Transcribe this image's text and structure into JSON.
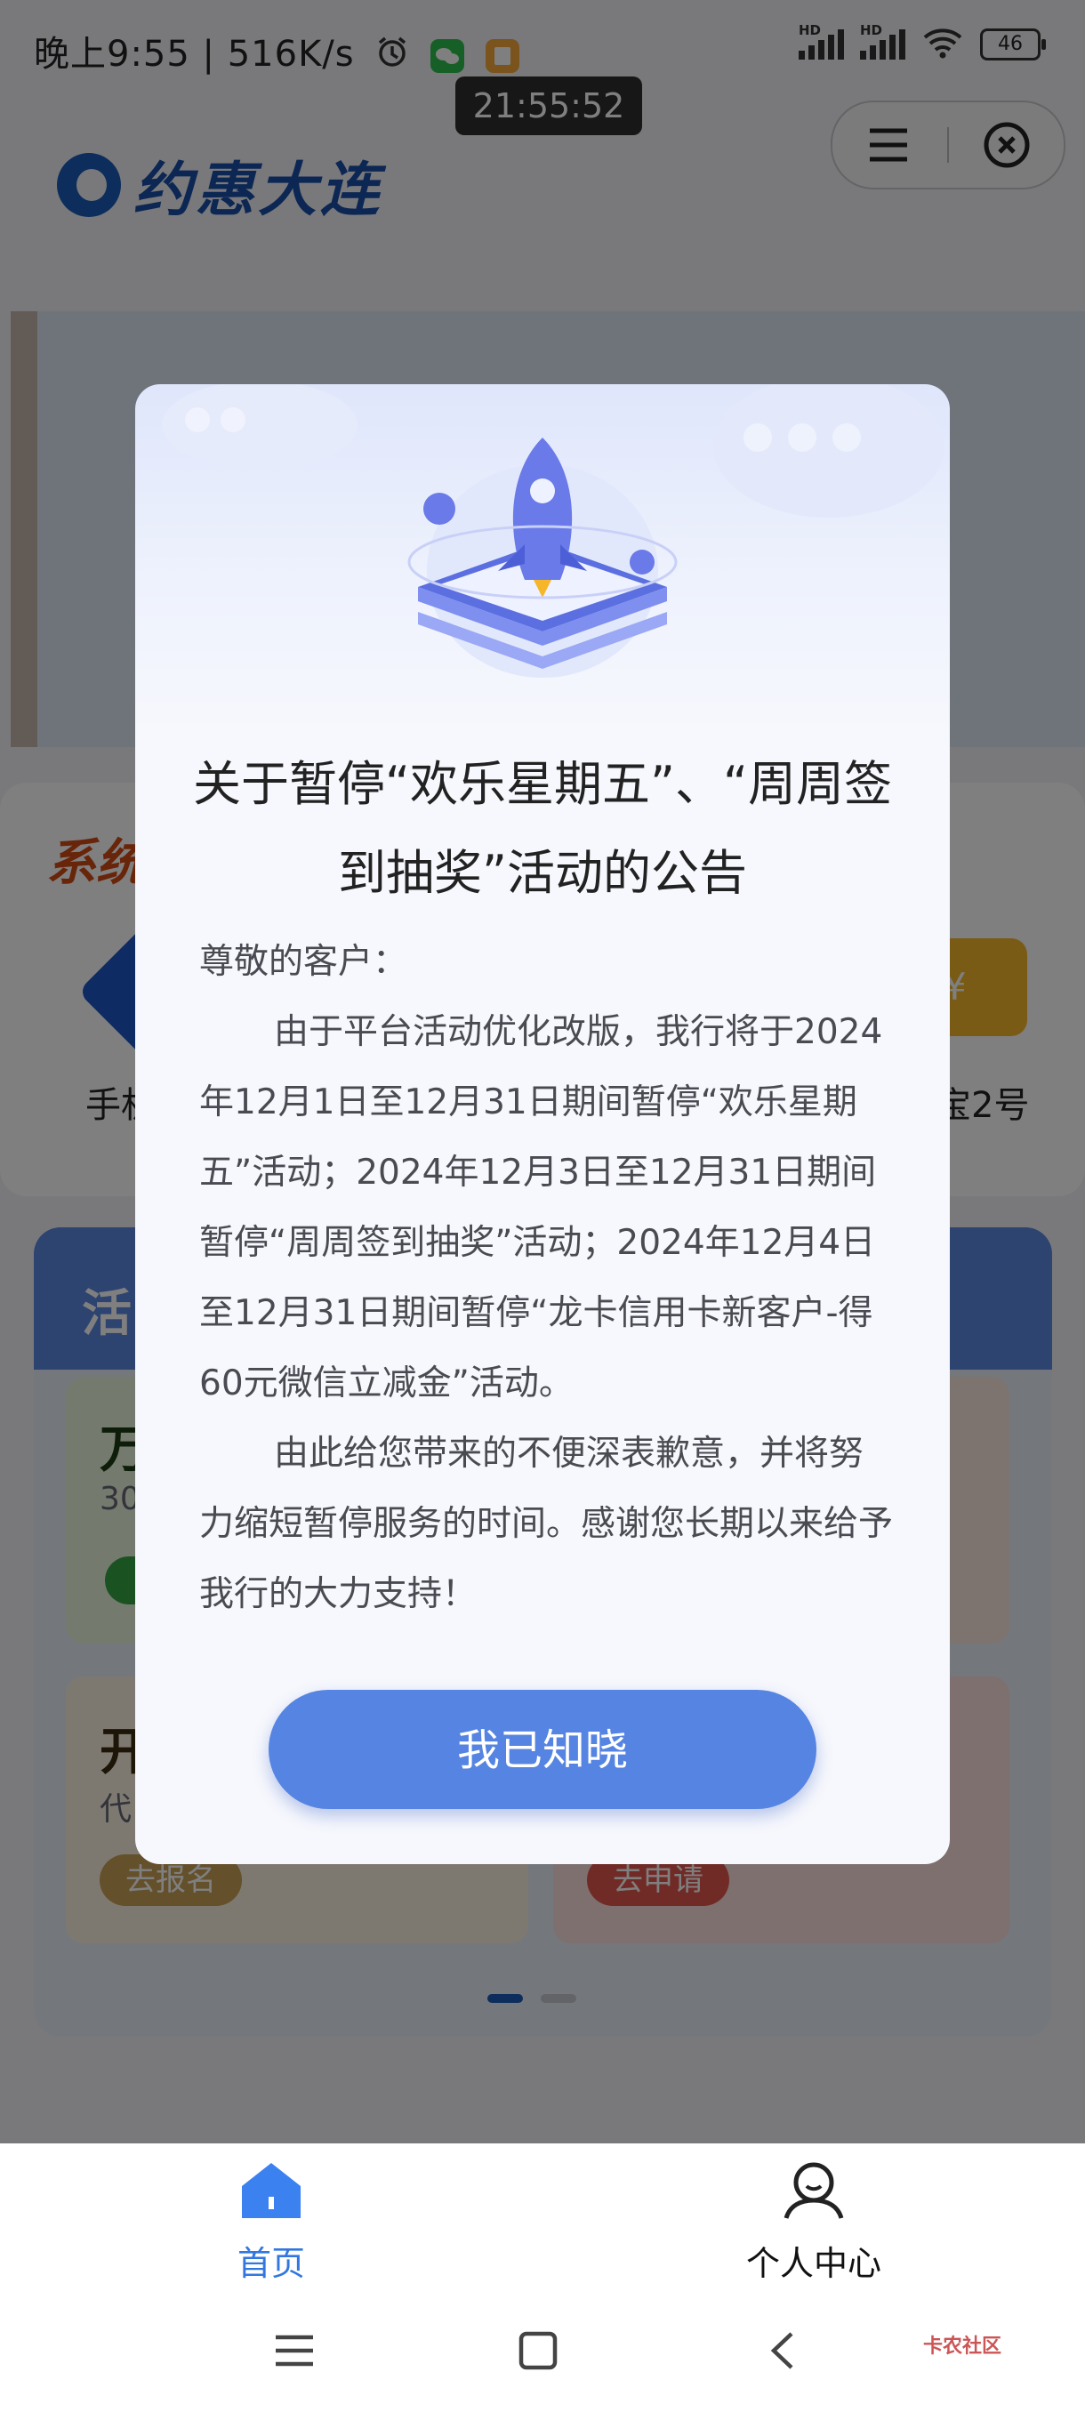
{
  "status_bar": {
    "time_and_speed": "晚上9:55 | 516K/s",
    "battery": "46",
    "overlay_clock": "21:55:52"
  },
  "header": {
    "logo_text": "约惠大连"
  },
  "background": {
    "section_title": "系统",
    "services": [
      "手机",
      "宝2号"
    ],
    "service_badge": "¥",
    "activity_title": "活",
    "tiles": [
      {
        "title": "万",
        "sub": "30",
        "button": ""
      },
      {
        "title": "开",
        "sub": "代",
        "button": "去报名"
      },
      {
        "title": "",
        "sub": "",
        "button": "去申请"
      }
    ]
  },
  "modal": {
    "title": "关于暂停“欢乐星期五”、“周周签到抽奖”活动的公告",
    "greeting": "尊敬的客户：",
    "paragraph1": "由于平台活动优化改版，我行将于2024年12月1日至12月31日期间暂停“欢乐星期五”活动；2024年12月3日至12月31日期间暂停“周周签到抽奖”活动；2024年12月4日至12月31日期间暂停“龙卡信用卡新客户-得60元微信立减金”活动。",
    "paragraph2": "由此给您带来的不便深表歉意，并将努力缩短暂停服务的时间。感谢您长期以来给予我行的大力支持！",
    "button": "我已知晓"
  },
  "tabbar": {
    "home": "首页",
    "user": "个人中心"
  },
  "watermark": "卡农社区",
  "colors": {
    "accent": "#5684e2",
    "home_active": "#3277e0",
    "brand": "#1a5ab8"
  },
  "icons": [
    "alarm-icon",
    "wechat-icon",
    "notes-icon",
    "signal-icon",
    "wifi-icon",
    "battery-icon",
    "menu-icon",
    "close-circle-icon",
    "rocket-illustration",
    "home-icon",
    "user-icon",
    "nav-menu-icon",
    "nav-home-icon",
    "nav-back-icon"
  ]
}
